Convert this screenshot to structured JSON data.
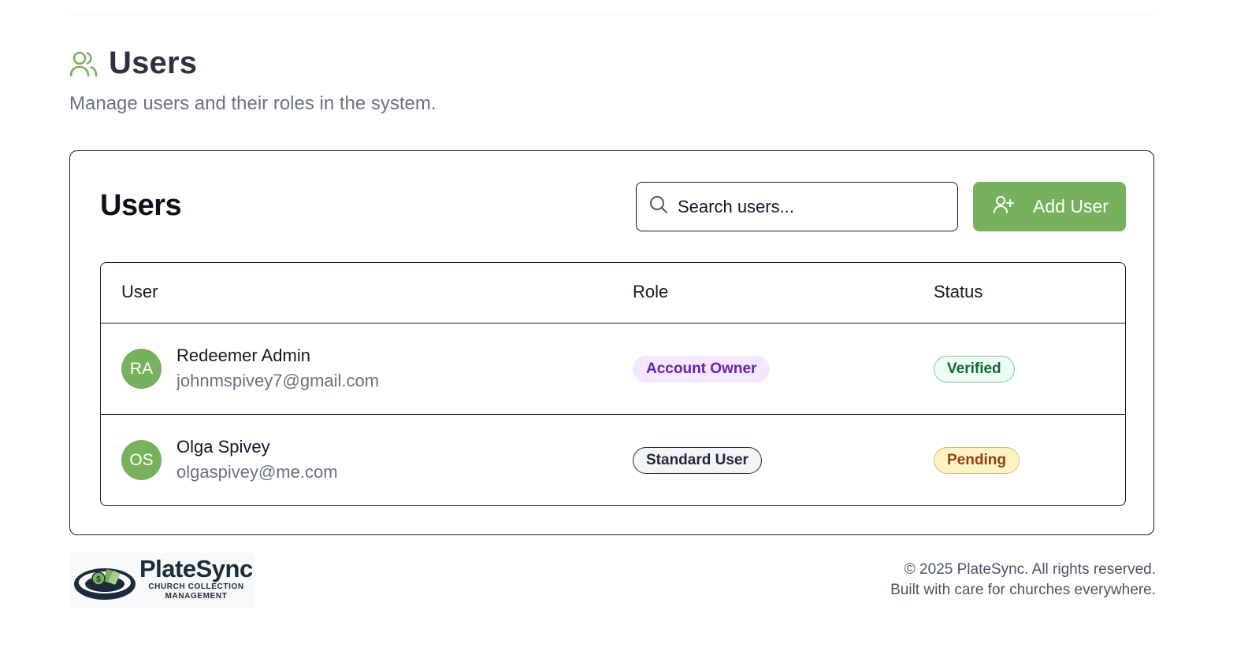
{
  "page": {
    "title": "Users",
    "subtitle": "Manage users and their roles in the system."
  },
  "card": {
    "title": "Users",
    "search_placeholder": "Search users...",
    "add_button_label": "Add User"
  },
  "table": {
    "columns": [
      "User",
      "Role",
      "Status"
    ],
    "rows": [
      {
        "initials": "RA",
        "name": "Redeemer Admin",
        "email": "johnmspivey7@gmail.com",
        "role": "Account Owner",
        "status": "Verified"
      },
      {
        "initials": "OS",
        "name": "Olga Spivey",
        "email": "olgaspivey@me.com",
        "role": "Standard User",
        "status": "Pending"
      }
    ]
  },
  "footer": {
    "logo_name": "PlateSync",
    "logo_tagline": "CHURCH COLLECTION MANAGEMENT",
    "copyright": "© 2025 PlateSync. All rights reserved.",
    "tagline": "Built with care for churches everywhere."
  },
  "colors": {
    "accent": "#78b15e",
    "owner_badge": "#f3e8ff",
    "verified_badge": "#ecfdf3",
    "pending_badge": "#fef3c7"
  },
  "icons": {
    "page_title": "users-icon",
    "search": "search-icon",
    "add_user": "user-plus-icon",
    "logo": "collection-plate-icon"
  }
}
